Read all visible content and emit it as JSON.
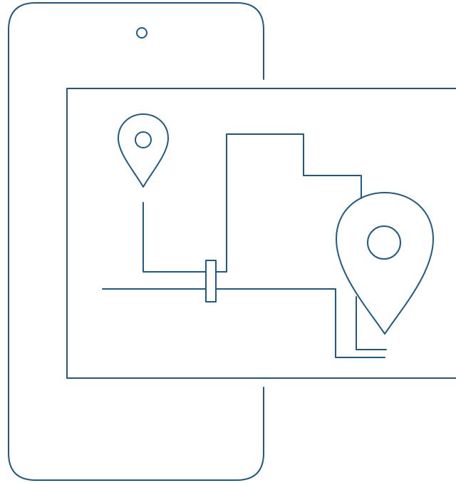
{
  "illustration": {
    "stroke_color": "#1f5a86",
    "background_color": "#ffffff",
    "icons": {
      "phone": "smartphone-outline-icon",
      "map": "map-route-outline-icon",
      "pin_small": "location-pin-icon",
      "pin_large": "location-pin-icon"
    }
  }
}
